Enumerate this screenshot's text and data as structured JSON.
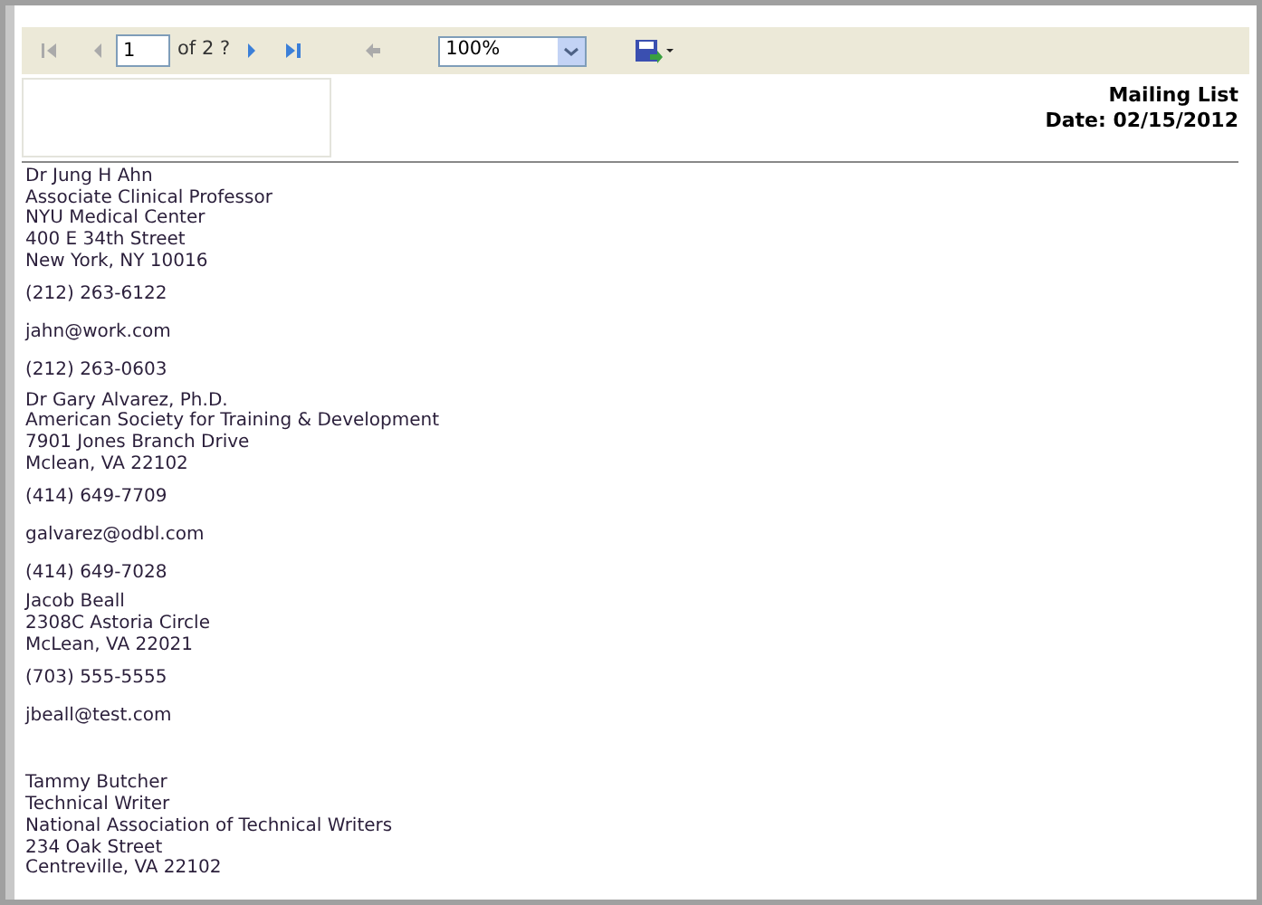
{
  "toolbar": {
    "page_input": "1",
    "page_count": "of 2 ?",
    "zoom": "100%"
  },
  "header": {
    "title": "Mailing List",
    "date": "Date: 02/15/2012"
  },
  "contacts": [
    {
      "address_lines": [
        "Dr Jung H Ahn",
        "Associate Clinical Professor",
        "NYU Medical Center",
        "400 E 34th Street",
        "New York, NY 10016"
      ],
      "phone": "(212) 263-6122",
      "email": "jahn@work.com",
      "phone_2": "(212) 263-0603"
    },
    {
      "address_lines": [
        "Dr Gary Alvarez, Ph.D.",
        "American Society for Training & Development",
        "7901 Jones Branch Drive",
        "Mclean, VA 22102"
      ],
      "phone": "(414) 649-7709",
      "email": "galvarez@odbl.com",
      "phone_2": "(414) 649-7028"
    },
    {
      "address_lines": [
        "Jacob Beall",
        "2308C Astoria Circle",
        "McLean, VA 22021"
      ],
      "phone": "(703) 555-5555",
      "email": "jbeall@test.com"
    },
    {
      "address_lines": [
        "Tammy Butcher",
        "Technical Writer",
        "National Association of Technical Writers",
        "234 Oak Street",
        "Centreville, VA 22102"
      ]
    }
  ]
}
